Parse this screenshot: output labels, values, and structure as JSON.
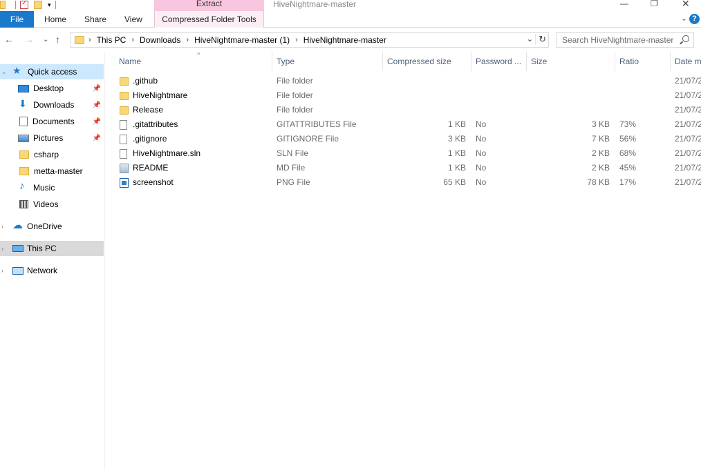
{
  "window": {
    "title": "HiveNightmare-master",
    "context_group": "Extract"
  },
  "ribbon": {
    "tabs": [
      {
        "label": "File"
      },
      {
        "label": "Home"
      },
      {
        "label": "Share"
      },
      {
        "label": "View"
      },
      {
        "label": "Compressed Folder Tools"
      }
    ],
    "help": "?"
  },
  "address": {
    "crumbs": [
      "This PC",
      "Downloads",
      "HiveNightmare-master (1)",
      "HiveNightmare-master"
    ]
  },
  "search": {
    "placeholder": "Search HiveNightmare-master"
  },
  "nav": {
    "items": [
      {
        "label": "Quick access",
        "icon": "star-icon"
      },
      {
        "label": "Desktop",
        "icon": "desktop-icon"
      },
      {
        "label": "Downloads",
        "icon": "downloads-icon"
      },
      {
        "label": "Documents",
        "icon": "documents-icon"
      },
      {
        "label": "Pictures",
        "icon": "pictures-icon"
      },
      {
        "label": "csharp",
        "icon": "folder-icon"
      },
      {
        "label": "metta-master",
        "icon": "folder-icon"
      },
      {
        "label": "Music",
        "icon": "music-icon"
      },
      {
        "label": "Videos",
        "icon": "videos-icon"
      },
      {
        "label": "OneDrive",
        "icon": "cloud-icon"
      },
      {
        "label": "This PC",
        "icon": "pc-icon"
      },
      {
        "label": "Network",
        "icon": "network-icon"
      }
    ]
  },
  "columns": {
    "name": "Name",
    "type": "Type",
    "compressed_size": "Compressed size",
    "password": "Password ...",
    "size": "Size",
    "ratio": "Ratio",
    "date": "Date m"
  },
  "files": [
    {
      "name": ".github",
      "type": "File folder",
      "compressed_size": "",
      "password": "",
      "size": "",
      "ratio": "",
      "date": "21/07/2"
    },
    {
      "name": "HiveNightmare",
      "type": "File folder",
      "compressed_size": "",
      "password": "",
      "size": "",
      "ratio": "",
      "date": "21/07/2"
    },
    {
      "name": "Release",
      "type": "File folder",
      "compressed_size": "",
      "password": "",
      "size": "",
      "ratio": "",
      "date": "21/07/2"
    },
    {
      "name": ".gitattributes",
      "type": "GITATTRIBUTES File",
      "compressed_size": "1 KB",
      "password": "No",
      "size": "3 KB",
      "ratio": "73%",
      "date": "21/07/2"
    },
    {
      "name": ".gitignore",
      "type": "GITIGNORE File",
      "compressed_size": "3 KB",
      "password": "No",
      "size": "7 KB",
      "ratio": "56%",
      "date": "21/07/2"
    },
    {
      "name": "HiveNightmare.sln",
      "type": "SLN File",
      "compressed_size": "1 KB",
      "password": "No",
      "size": "2 KB",
      "ratio": "68%",
      "date": "21/07/2"
    },
    {
      "name": "README",
      "type": "MD File",
      "compressed_size": "1 KB",
      "password": "No",
      "size": "2 KB",
      "ratio": "45%",
      "date": "21/07/2"
    },
    {
      "name": "screenshot",
      "type": "PNG File",
      "compressed_size": "65 KB",
      "password": "No",
      "size": "78 KB",
      "ratio": "17%",
      "date": "21/07/2"
    }
  ]
}
